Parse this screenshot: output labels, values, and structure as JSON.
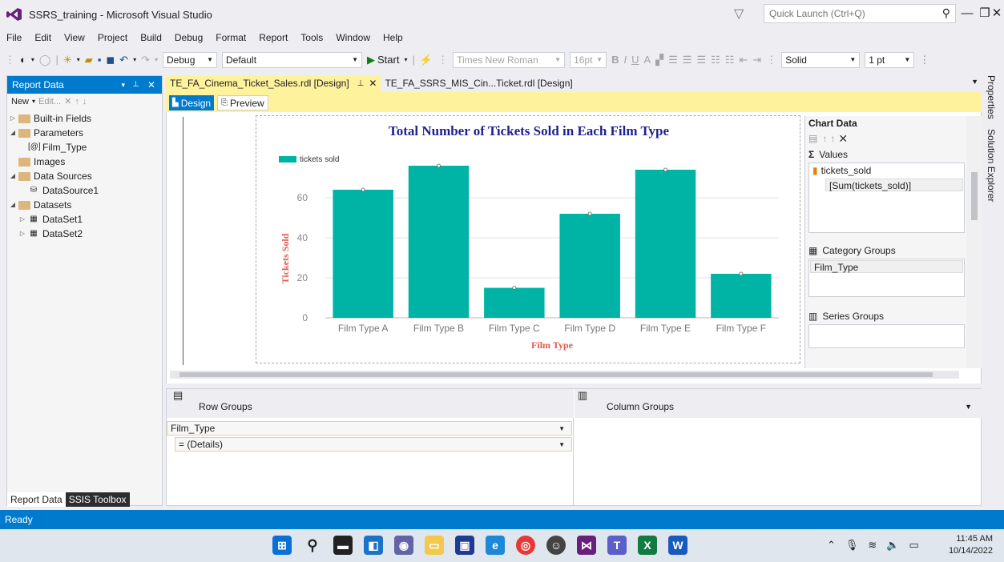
{
  "window": {
    "title": "SSRS_training - Microsoft Visual Studio",
    "quick_launch_placeholder": "Quick Launch (Ctrl+Q)"
  },
  "menu": [
    "File",
    "Edit",
    "View",
    "Project",
    "Build",
    "Debug",
    "Format",
    "Report",
    "Tools",
    "Window",
    "Help"
  ],
  "toolbar": {
    "config": "Debug",
    "platform": "Default",
    "start_label": "Start",
    "font": "Times New Roman",
    "font_size": "16pt",
    "bold": "B",
    "italic": "I",
    "underline": "U",
    "line_style": "Solid",
    "line_width": "1 pt"
  },
  "report_data": {
    "title": "Report Data",
    "new_label": "New",
    "edit_label": "Edit...",
    "tree": {
      "builtin": "Built-in Fields",
      "parameters": "Parameters",
      "param_film_type": "Film_Type",
      "images": "Images",
      "data_sources": "Data Sources",
      "datasource1": "DataSource1",
      "datasets": "Datasets",
      "dataset1": "DataSet1",
      "dataset2": "DataSet2"
    },
    "tab_report_data": "Report Data",
    "tab_ssis": "SSIS Toolbox"
  },
  "doc_tabs": {
    "active": "TE_FA_Cinema_Ticket_Sales.rdl [Design]",
    "inactive": "TE_FA_SSRS_MIS_Cin...Ticket.rdl [Design]",
    "design": "Design",
    "preview": "Preview"
  },
  "chart_data": {
    "type": "bar",
    "title": "Total Number of Tickets Sold in Each Film Type",
    "xlabel": "Film Type",
    "ylabel": "Tickets Sold",
    "categories": [
      "Film Type A",
      "Film Type B",
      "Film Type C",
      "Film Type D",
      "Film Type E",
      "Film Type F"
    ],
    "series": [
      {
        "name": "tickets sold",
        "values": [
          64,
          76,
          15,
          52,
          74,
          22
        ]
      }
    ],
    "y_ticks": [
      0,
      20,
      40,
      60
    ],
    "ylim": [
      0,
      80
    ],
    "grid": true,
    "legend": "top-left",
    "bar_color": "#00b4a5",
    "title_color": "#1f1f8f",
    "label_color": "#e05a4f"
  },
  "chart_pane": {
    "title": "Chart Data",
    "values_label": "Values",
    "value_field": "tickets_sold",
    "value_expr": "[Sum(tickets_sold)]",
    "category_label": "Category Groups",
    "category_field": "Film_Type",
    "series_label": "Series Groups"
  },
  "groups": {
    "row_label": "Row Groups",
    "column_label": "Column Groups",
    "row1": "Film_Type",
    "row2": "= (Details)"
  },
  "rail": {
    "properties": "Properties",
    "solution": "Solution Explorer"
  },
  "status": "Ready",
  "clock": {
    "time": "11:45 AM",
    "date": "10/14/2022"
  }
}
